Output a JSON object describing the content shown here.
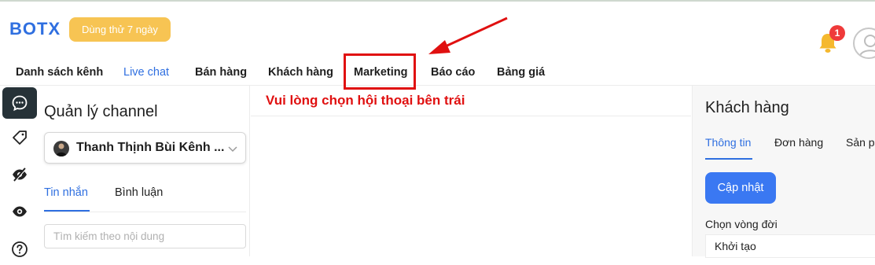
{
  "header": {
    "logo": "BOTX",
    "trial_label": "Dùng thử 7 ngày",
    "notification_count": "1"
  },
  "nav": {
    "items": [
      "Danh sách kênh",
      "Live chat",
      "Bán hàng",
      "Khách hàng",
      "Marketing",
      "Báo cáo",
      "Bảng giá"
    ],
    "active": "Live chat",
    "highlighted": "Marketing"
  },
  "rail": {
    "icons": [
      "chat-icon",
      "tag-icon",
      "eye-off-icon",
      "eye-icon",
      "help-icon"
    ],
    "active": "chat-icon"
  },
  "channel_panel": {
    "title": "Quản lý channel",
    "selected_channel": "Thanh Thịnh Bùi Kênh ...",
    "tabs": [
      "Tin nhắn",
      "Bình luận"
    ],
    "active_tab": "Tin nhắn",
    "search_placeholder": "Tìm kiếm theo nội dung"
  },
  "center": {
    "message": "Vui lòng chọn hội thoại bên trái"
  },
  "customer_panel": {
    "title": "Khách hàng",
    "tabs": [
      "Thông tin",
      "Đơn hàng",
      "Sản ph"
    ],
    "active_tab": "Thông tin",
    "update_button": "Cập nhật",
    "lifecycle_label": "Chọn vòng đời",
    "lifecycle_value": "Khởi tạo"
  },
  "colors": {
    "accent": "#2f6fe0",
    "trial_bg": "#f7c453",
    "annotation_red": "#e01010",
    "rail_active_bg": "#263238"
  }
}
